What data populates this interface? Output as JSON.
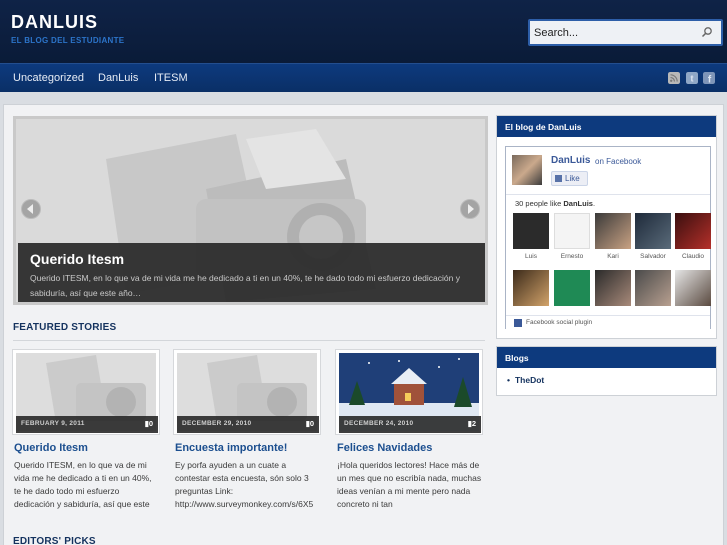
{
  "header": {
    "site_title": "DANLUIS",
    "tagline": "EL BLOG DEL ESTUDIANTE",
    "search_placeholder": "Search..."
  },
  "nav": {
    "items": [
      "Uncategorized",
      "DanLuis",
      "ITESM"
    ],
    "social_icons": [
      "rss-icon",
      "twitter-icon",
      "facebook-icon"
    ]
  },
  "slider": {
    "title": "Querido Itesm",
    "excerpt": "Querido ITESM, en lo que va de mi vida me he dedicado a ti en un 40%, te he dado todo mi esfuerzo dedicación y sabiduría, así que este año…"
  },
  "featured": {
    "heading": "FEATURED STORIES",
    "cards": [
      {
        "date": "FEBRUARY 9, 2011",
        "comments": "0",
        "title": "Querido Itesm",
        "excerpt": "Querido ITESM, en lo que va de mi vida me he dedicado a ti en un 40%, te he dado todo mi esfuerzo dedicación y sabiduría, así que este"
      },
      {
        "date": "DECEMBER 29, 2010",
        "comments": "0",
        "title": "Encuesta importante!",
        "excerpt": "Ey porfa ayuden a un cuate a contestar esta encuesta, són solo 3 preguntas Link: http://www.surveymonkey.com/s/6X5"
      },
      {
        "date": "DECEMBER 24, 2010",
        "comments": "2",
        "title": "Felices Navidades",
        "excerpt": "¡Hola queridos lectores! Hace más de un mes que no escribía nada, muchas ideas venían a mi mente pero nada concreto ni tan"
      }
    ]
  },
  "editors_picks": {
    "heading": "EDITORS' PICKS"
  },
  "sidebar": {
    "fb_widget": {
      "title": "El blog de DanLuis",
      "page_name": "DanLuis",
      "on_facebook": "on Facebook",
      "like_label": "Like",
      "count_prefix": "30 people like ",
      "count_name": "DanLuis",
      "count_suffix": ".",
      "fans": [
        "Luis",
        "Ernesto",
        "Kari",
        "Salvador",
        "Claudio",
        "",
        "",
        "",
        "",
        ""
      ],
      "plugin_label": "Facebook social plugin"
    },
    "blogs_widget": {
      "title": "Blogs",
      "items": [
        "TheDot"
      ]
    }
  },
  "colors": {
    "header_bg": "#0f2347",
    "nav_bg": "#0d3a7e",
    "widget_head": "#0d3a7e",
    "link": "#1c4f8f",
    "tagline": "#2c74c9"
  }
}
